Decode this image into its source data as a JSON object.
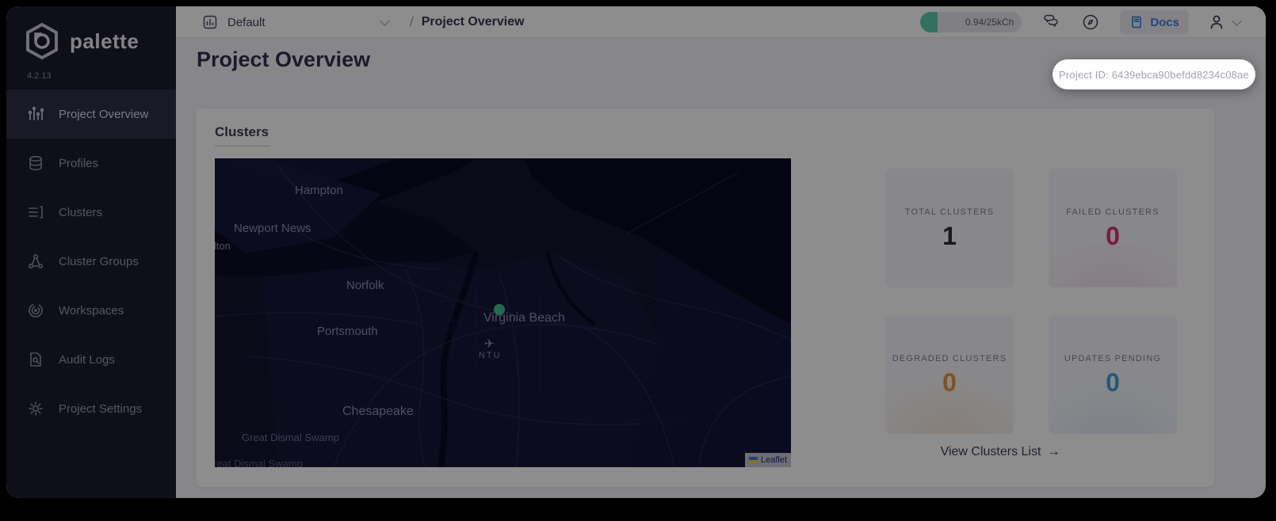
{
  "app": {
    "name": "palette",
    "version": "4.2.13"
  },
  "topbar": {
    "project_selector_value": "Default",
    "breadcrumb_separator": "/",
    "breadcrumb_current": "Project Overview",
    "usage_badge": "0.94/25kCh",
    "docs_label": "Docs"
  },
  "sidebar": {
    "items": [
      {
        "label": "Project Overview",
        "icon": "overview-icon",
        "active": true
      },
      {
        "label": "Profiles",
        "icon": "profiles-icon",
        "active": false
      },
      {
        "label": "Clusters",
        "icon": "clusters-icon",
        "active": false
      },
      {
        "label": "Cluster Groups",
        "icon": "cluster-groups-icon",
        "active": false
      },
      {
        "label": "Workspaces",
        "icon": "workspaces-icon",
        "active": false
      },
      {
        "label": "Audit Logs",
        "icon": "audit-logs-icon",
        "active": false
      },
      {
        "label": "Project Settings",
        "icon": "settings-icon",
        "active": false
      }
    ]
  },
  "page": {
    "title": "Project Overview",
    "project_id_tooltip": "Project ID: 6439ebca90befdd8234c08ae"
  },
  "clusters_panel": {
    "title": "Clusters",
    "map": {
      "labels": {
        "hampton": "Hampton",
        "newport_news": "Newport News",
        "carrollton_partial": "llton",
        "norfolk": "Norfolk",
        "virginia_beach": "Virginia Beach",
        "portsmouth": "Portsmouth",
        "chesapeake": "Chesapeake",
        "great_dismal_swamp": "Great Dismal Swamp",
        "great_dismal_swamp_edge": "Great Dismal Swamp"
      },
      "airport_icon": "✈",
      "airport_code": "NTU",
      "marker_color": "#42bd8d",
      "attribution_label": "Leaflet"
    },
    "stats": [
      {
        "label": "TOTAL CLUSTERS",
        "value": "1",
        "color": "#2b2b3a"
      },
      {
        "label": "FAILED CLUSTERS",
        "value": "0",
        "color": "#d8306b"
      },
      {
        "label": "DEGRADED CLUSTERS",
        "value": "0",
        "color": "#e0953a"
      },
      {
        "label": "UPDATES PENDING",
        "value": "0",
        "color": "#3e9fd4"
      }
    ],
    "view_link_label": "View Clusters List",
    "view_link_arrow": "→"
  }
}
